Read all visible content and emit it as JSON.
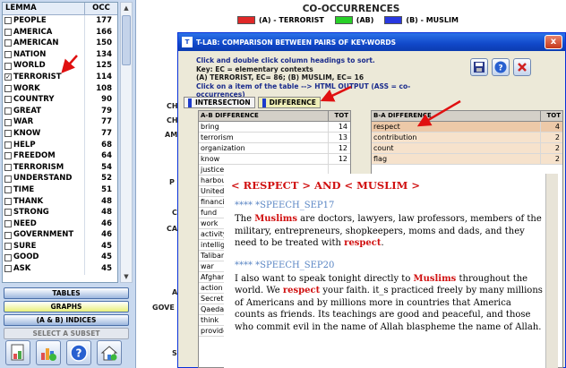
{
  "lemma_table": {
    "col_lemma": "LEMMA",
    "col_occ": "OCC",
    "rows": [
      {
        "word": "PEOPLE",
        "occ": "177",
        "checked": false
      },
      {
        "word": "AMERICA",
        "occ": "166",
        "checked": false
      },
      {
        "word": "AMERICAN",
        "occ": "150",
        "checked": false
      },
      {
        "word": "NATION",
        "occ": "134",
        "checked": false
      },
      {
        "word": "WORLD",
        "occ": "125",
        "checked": false
      },
      {
        "word": "TERRORIST",
        "occ": "114",
        "checked": true
      },
      {
        "word": "WORK",
        "occ": "108",
        "checked": false
      },
      {
        "word": "COUNTRY",
        "occ": "90",
        "checked": false
      },
      {
        "word": "GREAT",
        "occ": "79",
        "checked": false
      },
      {
        "word": "WAR",
        "occ": "77",
        "checked": false
      },
      {
        "word": "KNOW",
        "occ": "77",
        "checked": false
      },
      {
        "word": "HELP",
        "occ": "68",
        "checked": false
      },
      {
        "word": "FREEDOM",
        "occ": "64",
        "checked": false
      },
      {
        "word": "TERRORISM",
        "occ": "54",
        "checked": false
      },
      {
        "word": "UNDERSTAND",
        "occ": "52",
        "checked": false
      },
      {
        "word": "TIME",
        "occ": "51",
        "checked": false
      },
      {
        "word": "THANK",
        "occ": "48",
        "checked": false
      },
      {
        "word": "STRONG",
        "occ": "48",
        "checked": false
      },
      {
        "word": "NEED",
        "occ": "46",
        "checked": false
      },
      {
        "word": "GOVERNMENT",
        "occ": "46",
        "checked": false
      },
      {
        "word": "SURE",
        "occ": "45",
        "checked": false
      },
      {
        "word": "GOOD",
        "occ": "45",
        "checked": false
      },
      {
        "word": "ASK",
        "occ": "45",
        "checked": false
      }
    ]
  },
  "left_buttons": {
    "tables": "TABLES",
    "graphs": "GRAPHS",
    "indices": "(A & B)  INDICES",
    "subset": "SELECT A SUBSET"
  },
  "bottom_icons": [
    "document-icon",
    "bar-chart-icon",
    "help-icon",
    "home-icon"
  ],
  "header": {
    "title": "CO-OCCURRENCES",
    "legend": [
      {
        "label": "(A) - TERRORIST",
        "color": "#e02828"
      },
      {
        "label": "(AB)",
        "color": "#28d028"
      },
      {
        "label": "(B) - MUSLIM",
        "color": "#2838e0"
      }
    ]
  },
  "background_labels": [
    "CH",
    "CH",
    "AM",
    "P",
    "C",
    "CA",
    "A",
    "GOVE",
    "S"
  ],
  "dialog": {
    "title": "T-LAB: COMPARISON BETWEEN PAIRS OF KEY-WORDS",
    "close": "x",
    "info_line1": "Click and double click column headings to sort.",
    "info_line2": "Key: EC = elementary contexts",
    "info_line3": "(A) TERRORIST, EC= 86; (B) MUSLIM, EC= 16",
    "info_line4": "Click on a item of the table --> HTML OUTPUT (ASS = co-occurrences)",
    "tabs": [
      "INTERSECTION",
      "DIFFERENCE"
    ],
    "grid_a": {
      "head_word": "A-B DIFFERENCE",
      "head_tot": "TOT",
      "rows": [
        {
          "w": "bring",
          "t": "14"
        },
        {
          "w": "terrorism",
          "t": "13"
        },
        {
          "w": "organization",
          "t": "12"
        },
        {
          "w": "know",
          "t": "12"
        },
        {
          "w": "justice",
          "t": ""
        },
        {
          "w": "harbou",
          "t": ""
        },
        {
          "w": "United_",
          "t": ""
        },
        {
          "w": "financi",
          "t": ""
        },
        {
          "w": "fund",
          "t": ""
        },
        {
          "w": "work",
          "t": ""
        },
        {
          "w": "activity",
          "t": ""
        },
        {
          "w": "intellige",
          "t": ""
        },
        {
          "w": "Taliban",
          "t": ""
        },
        {
          "w": "war",
          "t": ""
        },
        {
          "w": "Afghan",
          "t": ""
        },
        {
          "w": "action",
          "t": ""
        },
        {
          "w": "Secret",
          "t": ""
        },
        {
          "w": "Qaeda",
          "t": ""
        },
        {
          "w": "think",
          "t": ""
        },
        {
          "w": "provide",
          "t": ""
        }
      ]
    },
    "grid_b": {
      "head_word": "B-A DIFFERENCE",
      "head_tot": "TOT",
      "rows": [
        {
          "w": "respect",
          "t": "4"
        },
        {
          "w": "contribution",
          "t": "2"
        },
        {
          "w": "count",
          "t": "2"
        },
        {
          "w": "flag",
          "t": "2"
        }
      ]
    }
  },
  "popup": {
    "title": "< RESPECT > AND < MUSLIM >",
    "speech1_head": "**** *SPEECH_SEP17",
    "speech1": [
      {
        "t": "The ",
        "k": false
      },
      {
        "t": "Muslims",
        "k": true
      },
      {
        "t": " are doctors, lawyers, law professors, members of the military, entrepreneurs, shopkeepers, moms and dads, and they need to be treated with ",
        "k": false
      },
      {
        "t": "respect",
        "k": true
      },
      {
        "t": ".",
        "k": false
      }
    ],
    "speech2_head": "**** *SPEECH_SEP20",
    "speech2": [
      {
        "t": "I also want to speak tonight directly to ",
        "k": false
      },
      {
        "t": "Muslims",
        "k": true
      },
      {
        "t": " throughout the world. We ",
        "k": false
      },
      {
        "t": "respect",
        "k": true
      },
      {
        "t": " your faith. it_s practiced freely by many millions of Americans and by millions more in countries that America counts as friends. Its teachings are good and peaceful, and those who commit evil in the name of Allah blaspheme the name of Allah.",
        "k": false
      }
    ]
  }
}
